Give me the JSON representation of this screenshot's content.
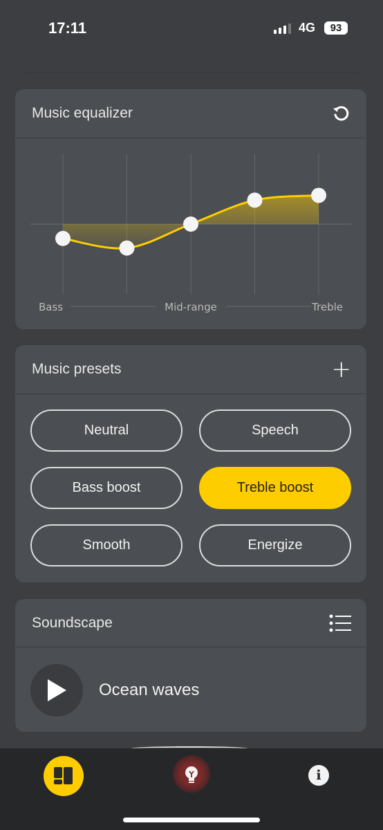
{
  "status_bar": {
    "time": "17:11",
    "network": "4G",
    "battery": "93"
  },
  "equalizer": {
    "title": "Music equalizer",
    "reset_icon": "reset-icon",
    "labels": {
      "low": "Bass",
      "mid": "Mid-range",
      "high": "Treble"
    },
    "band_levels": [
      -1.5,
      -2.5,
      0,
      2.5,
      3
    ],
    "level_range": [
      -7,
      7
    ],
    "accent": "#fecd00"
  },
  "presets": {
    "title": "Music presets",
    "add_icon": "plus-icon",
    "items": [
      {
        "label": "Neutral"
      },
      {
        "label": "Speech"
      },
      {
        "label": "Bass boost"
      },
      {
        "label": "Treble boost",
        "active": true
      },
      {
        "label": "Smooth"
      },
      {
        "label": "Energize"
      }
    ]
  },
  "soundscape": {
    "title": "Soundscape",
    "list_icon": "list-icon",
    "track": "Ocean waves",
    "play_icon": "play-icon"
  },
  "nav": {
    "items": [
      {
        "icon": "dashboard-icon",
        "active": true
      },
      {
        "icon": "lightbulb-icon"
      },
      {
        "icon": "info-icon"
      }
    ]
  }
}
